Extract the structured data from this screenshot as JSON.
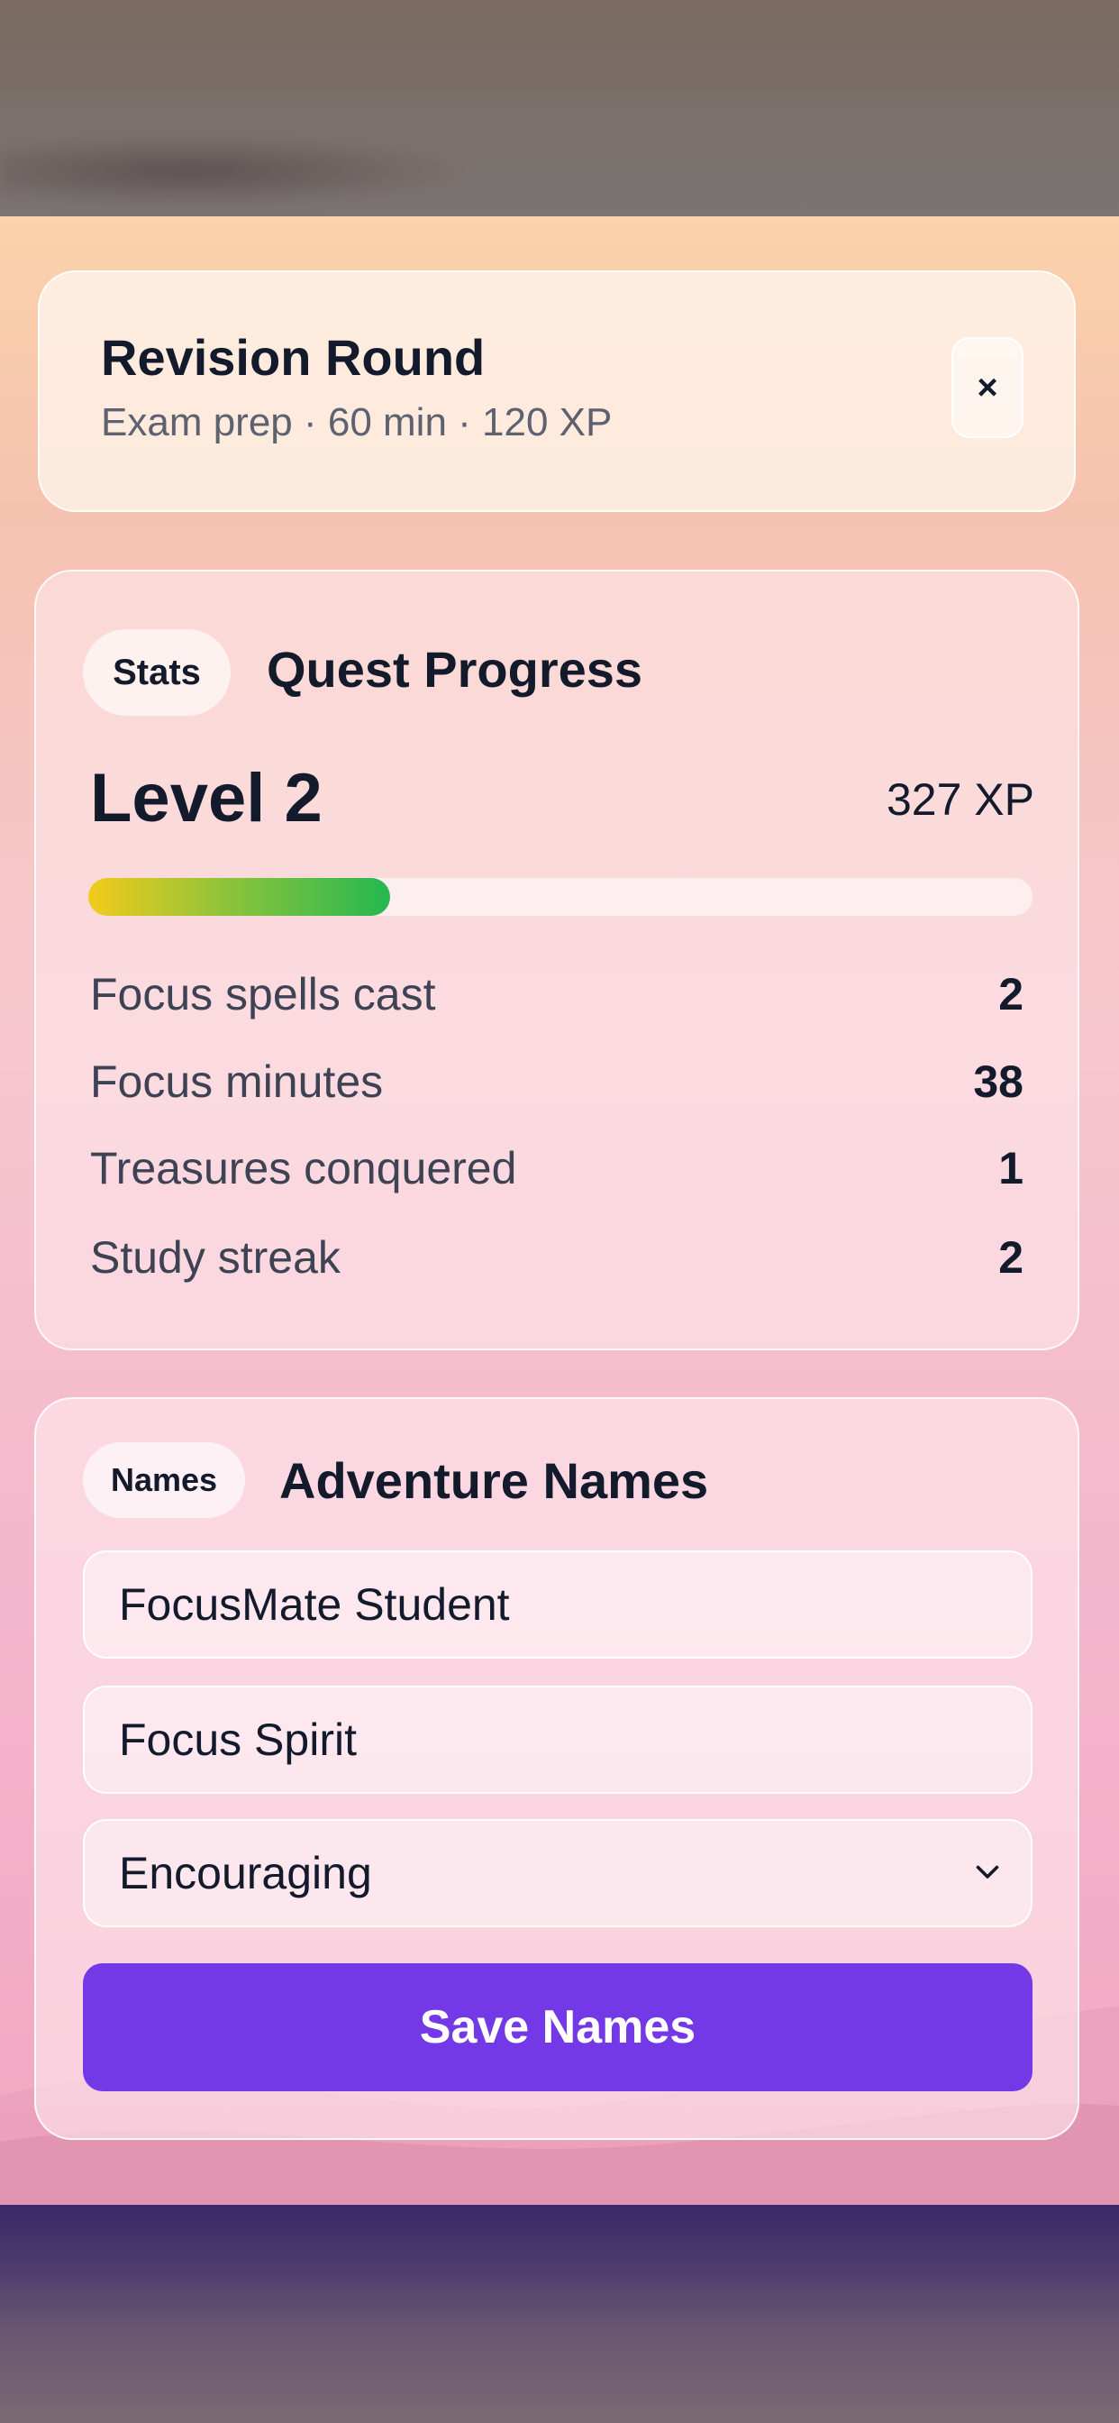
{
  "header": {
    "title": "Revision Round",
    "subtitle": "Exam prep · 60 min · 120 XP",
    "close_icon": "×"
  },
  "stats": {
    "badge": "Stats",
    "title": "Quest Progress",
    "level": "Level 2",
    "xp": "327 XP",
    "progress_fraction": 0.32,
    "progress_gradient": [
      "#f3cb1c",
      "#25b851"
    ],
    "rows": [
      {
        "label": "Focus spells cast",
        "value": "2"
      },
      {
        "label": "Focus minutes",
        "value": "38"
      },
      {
        "label": "Treasures conquered",
        "value": "1"
      },
      {
        "label": "Study streak",
        "value": "2"
      }
    ]
  },
  "names": {
    "badge": "Names",
    "title": "Adventure Names",
    "student_name": "FocusMate Student",
    "spirit_name": "Focus Spirit",
    "tone_selected": "Encouraging",
    "save_label": "Save Names"
  },
  "colors": {
    "accent": "#7439e6",
    "text": "#131a2b"
  }
}
